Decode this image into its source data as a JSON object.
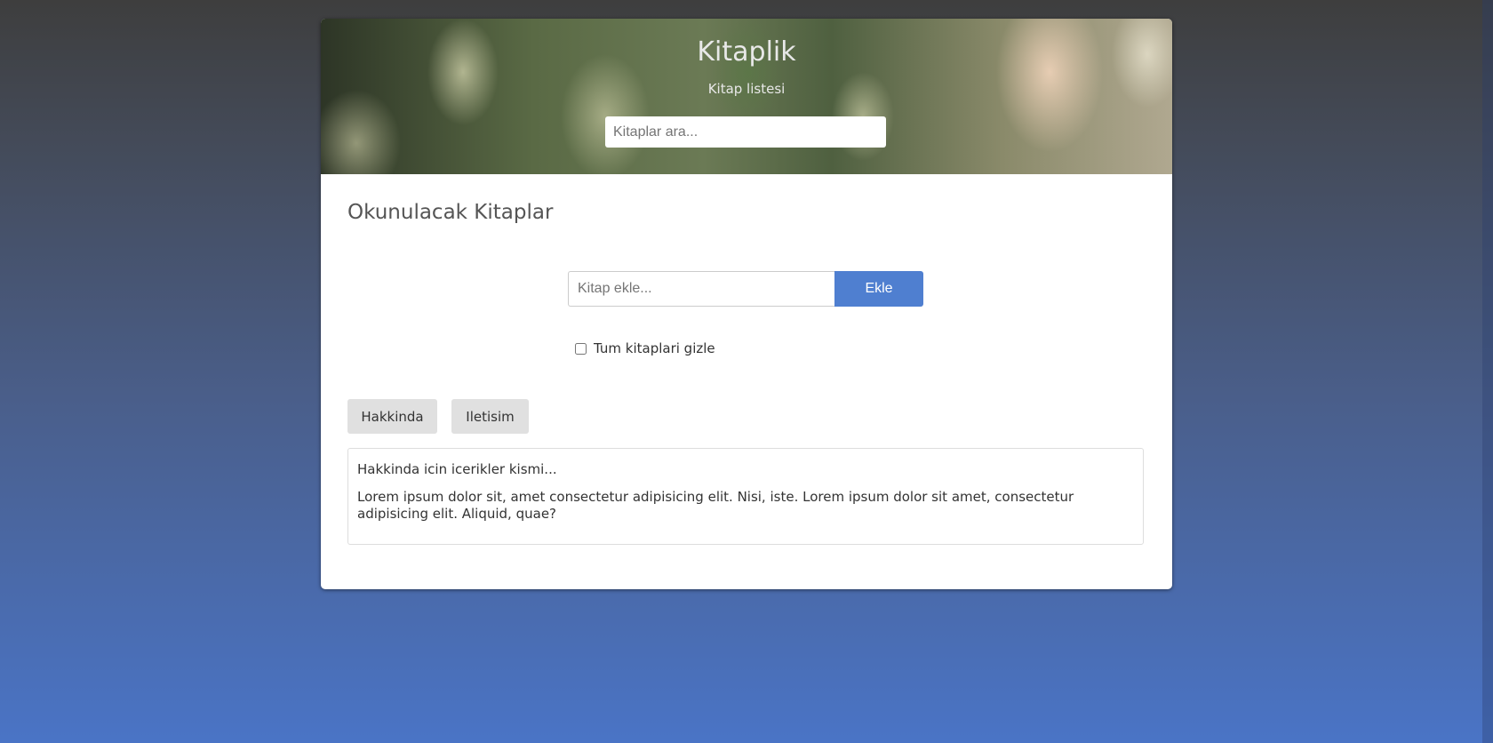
{
  "header": {
    "title": "Kitaplik",
    "subtitle": "Kitap listesi",
    "search_placeholder": "Kitaplar ara..."
  },
  "main": {
    "heading": "Okunulacak Kitaplar",
    "add_placeholder": "Kitap ekle...",
    "add_button": "Ekle",
    "hide_all_label": "Tum kitaplari gizle",
    "tabs": [
      {
        "label": "Hakkinda"
      },
      {
        "label": "Iletisim"
      }
    ],
    "content": {
      "title": "Hakkinda icin icerikler kismi...",
      "body": "Lorem ipsum dolor sit, amet consectetur adipisicing elit. Nisi, iste. Lorem ipsum dolor sit amet, consectetur adipisicing elit. Aliquid, quae?"
    }
  },
  "colors": {
    "accent": "#4f7fd0"
  }
}
